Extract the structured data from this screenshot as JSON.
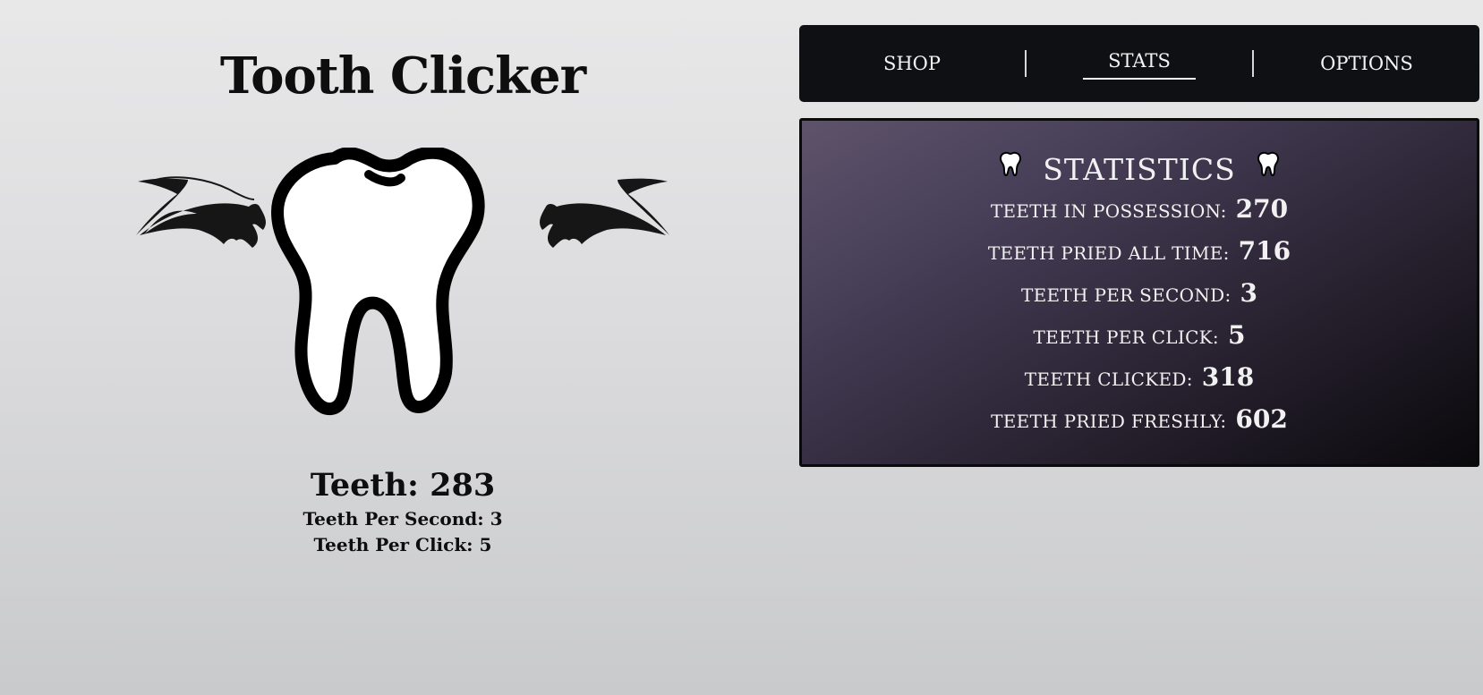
{
  "game": {
    "title": "Tooth Clicker",
    "teeth_display": "Teeth: 283",
    "tps_display": "Teeth Per Second: 3",
    "tpc_display": "Teeth Per Click: 5"
  },
  "nav": {
    "tabs": [
      {
        "label": "SHOP",
        "active": false
      },
      {
        "label": "STATS",
        "active": true
      },
      {
        "label": "OPTIONS",
        "active": false
      }
    ]
  },
  "stats": {
    "title": "STATISTICS",
    "rows": [
      {
        "label": "TEETH IN POSSESSION:",
        "value": "270"
      },
      {
        "label": "TEETH PRIED ALL TIME:",
        "value": "716"
      },
      {
        "label": "TEETH PER SECOND:",
        "value": "3"
      },
      {
        "label": "TEETH PER CLICK:",
        "value": "5"
      },
      {
        "label": "TEETH CLICKED:",
        "value": "318"
      },
      {
        "label": "TEETH PRIED FRESHLY:",
        "value": "602"
      }
    ]
  },
  "colors": {
    "nav_bg": "#0e1013",
    "panel_gradient_start": "#5e536a",
    "panel_gradient_end": "#0a090c",
    "text_dark": "#0e0e0e",
    "text_light": "#f1f1f1"
  },
  "icons": [
    "tooth-icon",
    "bat-wing-left-icon",
    "bat-wing-right-icon"
  ]
}
